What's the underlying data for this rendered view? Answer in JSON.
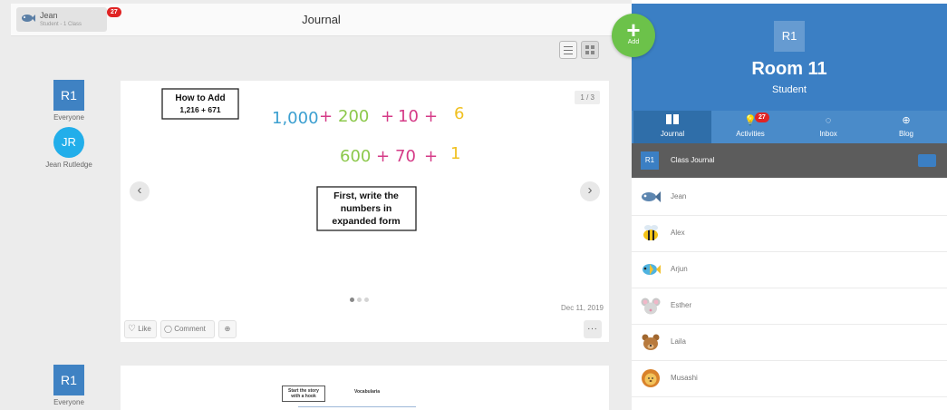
{
  "topbar": {
    "user_name": "Jean",
    "user_sub": "Student - 1 Class",
    "notif_count": "27",
    "title": "Journal"
  },
  "view_toggle": {
    "list_icon": "list-view-icon",
    "grid_icon": "grid-view-icon"
  },
  "add_button": {
    "label": "Add",
    "icon": "plus-icon"
  },
  "posts": [
    {
      "tag": "R1",
      "tag_label": "Everyone",
      "author_initials": "JR",
      "author_name": "Jean Rutledge",
      "page_indicator": "1 / 3",
      "content": {
        "title_box": "How to Add\n1,216 + 671",
        "line1_parts": [
          "1,000",
          "+",
          "200",
          "+",
          "10",
          "+",
          "6"
        ],
        "line2_parts": [
          "600",
          "+",
          "70",
          "+",
          "1"
        ],
        "instruction": "First, write the\nnumbers in\nexpanded form"
      },
      "date": "Dec 11, 2019",
      "like_label": "Like",
      "comment_label": "Comment",
      "more_label": "..."
    },
    {
      "tag": "R1",
      "tag_label": "Everyone",
      "content_title": "Start the story with a hook",
      "content_heading": "Vocabularia"
    }
  ],
  "room": {
    "tile": "R1",
    "name": "Room 11",
    "role": "Student"
  },
  "tabs": [
    {
      "label": "Journal",
      "icon": "journal-icon",
      "active": true
    },
    {
      "label": "Activities",
      "icon": "lightbulb-icon",
      "badge": "27"
    },
    {
      "label": "Inbox",
      "icon": "chat-icon"
    },
    {
      "label": "Blog",
      "icon": "globe-icon"
    }
  ],
  "class_journal": {
    "tile": "R1",
    "label": "Class Journal",
    "icon": "folder-icon"
  },
  "students": [
    {
      "name": "Jean",
      "avatar": "fish-avatar"
    },
    {
      "name": "Alex",
      "avatar": "bee-avatar"
    },
    {
      "name": "Arjun",
      "avatar": "tropical-fish-avatar"
    },
    {
      "name": "Esther",
      "avatar": "mouse-avatar"
    },
    {
      "name": "Laila",
      "avatar": "bear-avatar"
    },
    {
      "name": "Musashi",
      "avatar": "lion-avatar"
    }
  ],
  "colors": {
    "brand_blue": "#3b7fc4",
    "add_green": "#6cc24a",
    "badge_red": "#e02424",
    "selected_row": "#5c5c5c"
  }
}
